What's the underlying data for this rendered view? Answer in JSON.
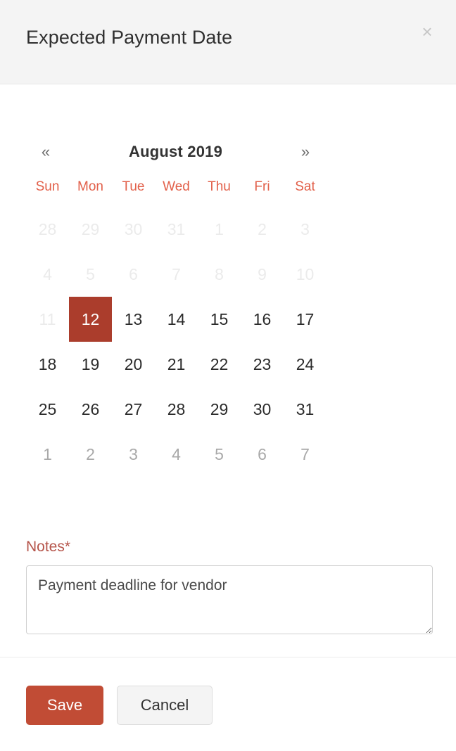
{
  "modal": {
    "title": "Expected Payment Date",
    "close_icon": "close-icon",
    "close_glyph": "×"
  },
  "datepicker": {
    "prev_glyph": "«",
    "next_glyph": "»",
    "month_label": "August 2019",
    "weekdays": [
      "Sun",
      "Mon",
      "Tue",
      "Wed",
      "Thu",
      "Fri",
      "Sat"
    ],
    "selected_day": "12",
    "weeks": [
      [
        {
          "label": "28",
          "state": "muted"
        },
        {
          "label": "29",
          "state": "muted"
        },
        {
          "label": "30",
          "state": "muted"
        },
        {
          "label": "31",
          "state": "muted"
        },
        {
          "label": "1",
          "state": "muted"
        },
        {
          "label": "2",
          "state": "muted"
        },
        {
          "label": "3",
          "state": "muted"
        }
      ],
      [
        {
          "label": "4",
          "state": "muted"
        },
        {
          "label": "5",
          "state": "muted"
        },
        {
          "label": "6",
          "state": "muted"
        },
        {
          "label": "7",
          "state": "muted"
        },
        {
          "label": "8",
          "state": "muted"
        },
        {
          "label": "9",
          "state": "muted"
        },
        {
          "label": "10",
          "state": "muted"
        }
      ],
      [
        {
          "label": "11",
          "state": "muted"
        },
        {
          "label": "12",
          "state": "selected"
        },
        {
          "label": "13",
          "state": "normal"
        },
        {
          "label": "14",
          "state": "normal"
        },
        {
          "label": "15",
          "state": "normal"
        },
        {
          "label": "16",
          "state": "normal"
        },
        {
          "label": "17",
          "state": "normal"
        }
      ],
      [
        {
          "label": "18",
          "state": "normal"
        },
        {
          "label": "19",
          "state": "normal"
        },
        {
          "label": "20",
          "state": "normal"
        },
        {
          "label": "21",
          "state": "normal"
        },
        {
          "label": "22",
          "state": "normal"
        },
        {
          "label": "23",
          "state": "normal"
        },
        {
          "label": "24",
          "state": "normal"
        }
      ],
      [
        {
          "label": "25",
          "state": "normal"
        },
        {
          "label": "26",
          "state": "normal"
        },
        {
          "label": "27",
          "state": "normal"
        },
        {
          "label": "28",
          "state": "normal"
        },
        {
          "label": "29",
          "state": "normal"
        },
        {
          "label": "30",
          "state": "normal"
        },
        {
          "label": "31",
          "state": "normal"
        }
      ],
      [
        {
          "label": "1",
          "state": "next-month"
        },
        {
          "label": "2",
          "state": "next-month"
        },
        {
          "label": "3",
          "state": "next-month"
        },
        {
          "label": "4",
          "state": "next-month"
        },
        {
          "label": "5",
          "state": "next-month"
        },
        {
          "label": "6",
          "state": "next-month"
        },
        {
          "label": "7",
          "state": "next-month"
        }
      ]
    ]
  },
  "notes": {
    "label": "Notes*",
    "value": "Payment deadline for vendor",
    "placeholder": ""
  },
  "footer": {
    "save_label": "Save",
    "cancel_label": "Cancel"
  },
  "colors": {
    "accent_selected": "#ab3d2c",
    "accent_button": "#c14c35",
    "weekday_red": "#e2604a",
    "label_red": "#b5544a",
    "header_bg": "#f4f4f4",
    "muted_day": "#ebebeb",
    "next_month_day": "#a9a9a9"
  }
}
